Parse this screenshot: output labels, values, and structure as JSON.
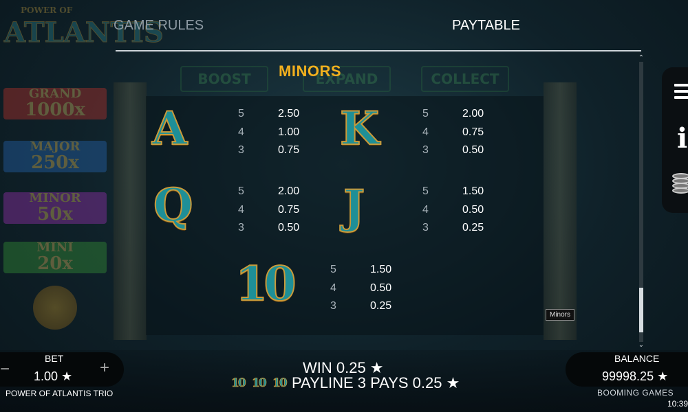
{
  "background": {
    "logo_line1": "POWER OF",
    "logo_line2": "ATLANTIS",
    "jackpots": [
      {
        "title": "GRAND",
        "value": "1000x",
        "color": "#d8342b"
      },
      {
        "title": "MAJOR",
        "value": "250x",
        "color": "#2a72c9"
      },
      {
        "title": "MINOR",
        "value": "50x",
        "color": "#b234c9"
      },
      {
        "title": "MINI",
        "value": "20x",
        "color": "#3da83a"
      }
    ],
    "tabs": [
      "BOOST",
      "EXPAND",
      "COLLECT"
    ]
  },
  "header": {
    "tab_rules": "GAME RULES",
    "tab_paytable": "PAYTABLE"
  },
  "section": {
    "title": "MINORS"
  },
  "paytable": {
    "symbols": [
      {
        "symbol": "A",
        "pays": [
          {
            "count": "5",
            "value": "2.50"
          },
          {
            "count": "4",
            "value": "1.00"
          },
          {
            "count": "3",
            "value": "0.75"
          }
        ]
      },
      {
        "symbol": "K",
        "pays": [
          {
            "count": "5",
            "value": "2.00"
          },
          {
            "count": "4",
            "value": "0.75"
          },
          {
            "count": "3",
            "value": "0.50"
          }
        ]
      },
      {
        "symbol": "Q",
        "pays": [
          {
            "count": "5",
            "value": "2.00"
          },
          {
            "count": "4",
            "value": "0.75"
          },
          {
            "count": "3",
            "value": "0.50"
          }
        ]
      },
      {
        "symbol": "J",
        "pays": [
          {
            "count": "5",
            "value": "1.50"
          },
          {
            "count": "4",
            "value": "0.50"
          },
          {
            "count": "3",
            "value": "0.25"
          }
        ]
      },
      {
        "symbol": "10",
        "pays": [
          {
            "count": "5",
            "value": "1.50"
          },
          {
            "count": "4",
            "value": "0.50"
          },
          {
            "count": "3",
            "value": "0.25"
          }
        ]
      }
    ]
  },
  "scroll": {
    "position_fraction": 0.96,
    "thumb_fraction": 0.16,
    "up_glyph": "⌃",
    "down_glyph": "⌄"
  },
  "tooltip": "Minors",
  "side_menu": {
    "icons": [
      "menu-icon",
      "info-icon",
      "coins-icon"
    ],
    "info_glyph": "i"
  },
  "bottom": {
    "bet_label": "BET",
    "bet_value": "1.00 ★",
    "minus": "−",
    "plus": "+",
    "game_name": "POWER OF ATLANTIS TRIO",
    "win_text": "WIN 0.25 ★",
    "payline_symbols": [
      "10",
      "10",
      "10"
    ],
    "payline_text": "PAYLINE 3 PAYS 0.25 ★",
    "balance_label": "BALANCE",
    "balance_value": "99998.25 ★",
    "brand": "BOOMING GAMES",
    "clock": "10:39"
  }
}
